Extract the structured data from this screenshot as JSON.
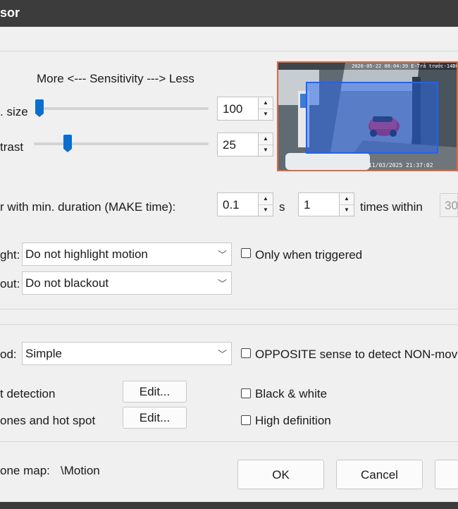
{
  "window": {
    "title": "sor"
  },
  "sensitivity": {
    "header": "More <--- Sensitivity ---> Less",
    "size": {
      "label": ". size",
      "value": "100",
      "slider_fraction": 0.0
    },
    "contrast": {
      "label": "trast",
      "value": "25",
      "slider_fraction": 0.18
    }
  },
  "preview": {
    "timestamp_top": "2020-05-22 08:04:39 E-Trả trước-14B028",
    "timestamp_bottom": "11/03/2025 21:37:02",
    "zone_color": "#1e63ff",
    "border_color": "#e06a3c"
  },
  "trigger": {
    "label": "r with min. duration (MAKE time):",
    "duration_value": "0.1",
    "duration_unit": "s",
    "times_value": "1",
    "times_label": "times within",
    "within_value": "30"
  },
  "highlight": {
    "label": "ght:",
    "value": "Do not highlight motion",
    "only_when_triggered": "Only when triggered"
  },
  "blackout": {
    "label": "out:",
    "value": "Do not blackout"
  },
  "method": {
    "label": "od:",
    "value": "Simple",
    "opposite_label": "OPPOSITE sense to detect NON-mov"
  },
  "detection": {
    "label": "t detection",
    "edit": "Edit..."
  },
  "zones": {
    "label": "ones and hot spot",
    "edit": "Edit..."
  },
  "options": {
    "black_white": "Black & white",
    "high_definition": "High definition"
  },
  "zone_map": {
    "label": "one map:",
    "value": "\\Motion"
  },
  "buttons": {
    "ok": "OK",
    "cancel": "Cancel"
  },
  "colors": {
    "accent": "#0a6ed1",
    "titlebar": "#3c3c3c"
  }
}
